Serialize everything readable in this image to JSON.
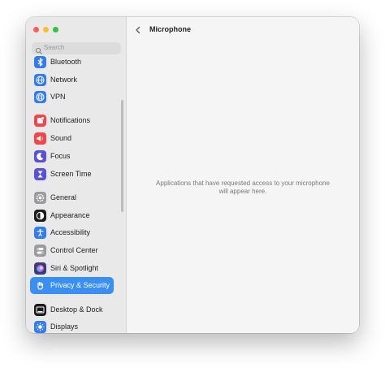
{
  "window": {
    "traffic_lights": [
      "#ff5f57",
      "#febc2e",
      "#28c840"
    ]
  },
  "search": {
    "placeholder": "Search",
    "icon": "search-icon"
  },
  "sidebar": {
    "items": [
      {
        "label": "Bluetooth",
        "icon": "bluetooth-icon",
        "color": "#2f7cf6"
      },
      {
        "label": "Network",
        "icon": "globe-icon",
        "color": "#2f7cf6"
      },
      {
        "label": "VPN",
        "icon": "vpn-globe-icon",
        "color": "#2f7cf6"
      },
      {
        "label": "Notifications",
        "icon": "bell-icon",
        "color": "#f2464a"
      },
      {
        "label": "Sound",
        "icon": "speaker-icon",
        "color": "#f2464a"
      },
      {
        "label": "Focus",
        "icon": "moon-icon",
        "color": "#5a52d6"
      },
      {
        "label": "Screen Time",
        "icon": "hourglass-icon",
        "color": "#5a52d6"
      },
      {
        "label": "General",
        "icon": "gear-icon",
        "color": "#9a9a9f"
      },
      {
        "label": "Appearance",
        "icon": "appearance-icon",
        "color": "#1c1c1e"
      },
      {
        "label": "Accessibility",
        "icon": "accessibility-icon",
        "color": "#2f7cf6"
      },
      {
        "label": "Control Center",
        "icon": "control-center-icon",
        "color": "#9a9a9f"
      },
      {
        "label": "Siri & Spotlight",
        "icon": "siri-icon",
        "color": "#3b3b7a"
      },
      {
        "label": "Privacy & Security",
        "icon": "hand-icon",
        "color": "#2f7cf6",
        "selected": true
      },
      {
        "label": "Desktop & Dock",
        "icon": "dock-icon",
        "color": "#1c1c1e"
      },
      {
        "label": "Displays",
        "icon": "sun-icon",
        "color": "#2f7cf6"
      }
    ]
  },
  "header": {
    "title": "Microphone",
    "back_icon": "chevron-left-icon"
  },
  "main": {
    "empty_message": "Applications that have requested access to your microphone will appear here."
  }
}
